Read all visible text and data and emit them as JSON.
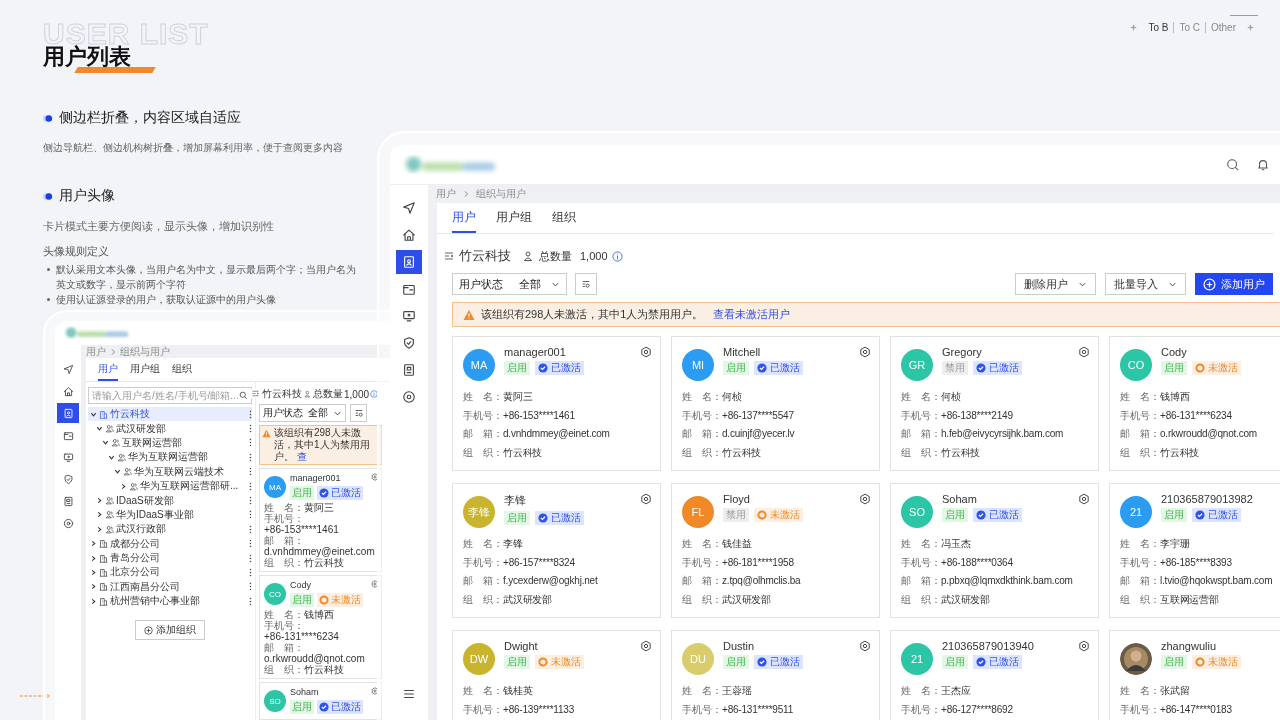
{
  "header": {
    "watermark": "USER LIST",
    "title": "用户列表",
    "links": [
      {
        "label": "To B",
        "selected": true
      },
      {
        "label": "To C",
        "selected": false
      },
      {
        "label": "Other",
        "selected": false
      }
    ]
  },
  "sections": [
    {
      "heading": "侧边栏折叠，内容区域自适应",
      "text": "侧边导航栏、侧边机构树折叠，增加屏幕利用率，便于查阅更多内容"
    },
    {
      "heading": "用户头像",
      "text": "卡片模式主要方便阅读，显示头像，增加识别性",
      "subheading": "头像规则定义",
      "bullets": [
        "默认采用文本头像，当用户名为中文，显示最后两个字；当用户名为英文或数字，显示前两个字符",
        "使用认证源登录的用户，获取认证源中的用户头像"
      ]
    }
  ],
  "mini": {
    "nav": [
      {
        "kind": "send",
        "selected": false
      },
      {
        "kind": "home",
        "selected": false
      },
      {
        "kind": "user",
        "selected": true
      },
      {
        "kind": "folder",
        "selected": false
      },
      {
        "kind": "monitor",
        "selected": false
      },
      {
        "kind": "shield",
        "selected": false
      },
      {
        "kind": "badge",
        "selected": false
      },
      {
        "kind": "settings",
        "selected": false
      }
    ],
    "breadcrumb": [
      "用户",
      "组织与用户"
    ],
    "tabs": [
      {
        "label": "用户",
        "selected": true
      },
      {
        "label": "用户组",
        "selected": false
      },
      {
        "label": "组织",
        "selected": false
      }
    ],
    "search": {
      "placeholder": "请输入用户名/姓名/手机号/邮箱..."
    },
    "tree": [
      {
        "label": "竹云科技",
        "kind": "org",
        "expanded": true,
        "selected": true,
        "children": [
          {
            "label": "武汉研发部",
            "kind": "dept",
            "expanded": true,
            "selected": false,
            "children": [
              {
                "label": "互联网运营部",
                "kind": "dept",
                "expanded": true,
                "selected": false,
                "children": [
                  {
                    "label": "华为互联网运营部",
                    "kind": "dept",
                    "expanded": true,
                    "selected": false,
                    "children": [
                      {
                        "label": "华为互联网云端技术",
                        "kind": "dept",
                        "expanded": true,
                        "selected": false,
                        "children": [
                          {
                            "label": "华为互联网运营部研...",
                            "kind": "dept",
                            "expanded": false,
                            "selected": false
                          }
                        ]
                      }
                    ]
                  }
                ]
              }
            ]
          },
          {
            "label": "IDaaS研发部",
            "kind": "dept",
            "expanded": false,
            "selected": false
          },
          {
            "label": "华为IDaaS事业部",
            "kind": "dept",
            "expanded": false,
            "selected": false
          },
          {
            "label": "武汉行政部",
            "kind": "dept",
            "expanded": false,
            "selected": false
          }
        ]
      },
      {
        "label": "成都分公司",
        "kind": "org",
        "expanded": false,
        "selected": false
      },
      {
        "label": "青岛分公司",
        "kind": "org",
        "expanded": false,
        "selected": false
      },
      {
        "label": "北京分公司",
        "kind": "org",
        "expanded": false,
        "selected": false
      },
      {
        "label": "江西南昌分公司",
        "kind": "org",
        "expanded": false,
        "selected": false
      },
      {
        "label": "杭州营销中心事业部",
        "kind": "org",
        "expanded": false,
        "selected": false
      }
    ],
    "add_org": "添加组织",
    "org": "竹云科技",
    "total_label": "总数量",
    "total": "1,000",
    "filter": {
      "label": "用户状态",
      "value": "全部"
    },
    "alert": {
      "text": "该组织有298人未激活，其中1人为禁用用户。",
      "link": "查"
    },
    "cards": [
      {
        "kind": "text",
        "avatar": "MA",
        "color": "#2b9cf2",
        "name": "manager001",
        "settings": true,
        "status": {
          "text": "启用",
          "enabled": true
        },
        "activation": {
          "text": "已激活",
          "activated": true
        },
        "fields": [
          {
            "label": "姓　名：",
            "value": "黄阿三"
          },
          {
            "label": "手机号：",
            "value": "+86-153****1461"
          },
          {
            "label": "邮　箱：",
            "value": "d.vnhdmmey@einet.com"
          },
          {
            "label": "组　织：",
            "value": "竹云科技"
          }
        ]
      },
      {
        "kind": "text",
        "avatar": "CO",
        "color": "#2cc5a5",
        "name": "Cody",
        "settings": true,
        "status": {
          "text": "启用",
          "enabled": true
        },
        "activation": {
          "text": "未激活",
          "activated": false
        },
        "fields": [
          {
            "label": "姓　名：",
            "value": "钱博西"
          },
          {
            "label": "手机号：",
            "value": "+86-131****6234"
          },
          {
            "label": "邮　箱：",
            "value": "o.rkwroudd@qnot.com"
          },
          {
            "label": "组　织：",
            "value": "竹云科技"
          }
        ]
      },
      {
        "kind": "text",
        "avatar": "SO",
        "color": "#2cc5a5",
        "name": "Soham",
        "settings": true,
        "status": {
          "text": "启用",
          "enabled": true
        },
        "activation": {
          "text": "已激活",
          "activated": true
        }
      }
    ]
  },
  "main": {
    "nav": [
      {
        "kind": "send",
        "selected": false
      },
      {
        "kind": "home",
        "selected": false
      },
      {
        "kind": "user",
        "selected": true
      },
      {
        "kind": "folder",
        "selected": false
      },
      {
        "kind": "monitor",
        "selected": false
      },
      {
        "kind": "shield",
        "selected": false
      },
      {
        "kind": "badge",
        "selected": false
      },
      {
        "kind": "settings",
        "selected": false
      }
    ],
    "bottom_nav": [
      {
        "kind": "list",
        "selected": false
      }
    ],
    "breadcrumb": [
      "用户",
      "组织与用户"
    ],
    "tabs": [
      {
        "label": "用户",
        "selected": true
      },
      {
        "label": "用户组",
        "selected": false
      },
      {
        "label": "组织",
        "selected": false
      }
    ],
    "org": "竹云科技",
    "total_label": "总数量",
    "total": "1,000",
    "filter": {
      "label": "用户状态",
      "value": "全部"
    },
    "actions": [
      {
        "label": "删除用户",
        "kind": "dropdown"
      },
      {
        "label": "批量导入",
        "kind": "dropdown"
      },
      {
        "label": "添加用户",
        "kind": "primary"
      }
    ],
    "alert": {
      "text": "该组织有298人未激活，其中1人为禁用用户。",
      "link": "查看未激活用户"
    },
    "cards": [
      {
        "kind": "text",
        "avatar": "MA",
        "color": "#2b9cf2",
        "name": "manager001",
        "settings": true,
        "status": {
          "text": "启用",
          "enabled": true
        },
        "activation": {
          "text": "已激活",
          "activated": true
        },
        "fields": [
          {
            "label": "姓　名：",
            "value": "黄阿三"
          },
          {
            "label": "手机号：",
            "value": "+86-153****1461"
          },
          {
            "label": "邮　箱：",
            "value": "d.vnhdmmey@einet.com"
          },
          {
            "label": "组　织：",
            "value": "竹云科技"
          }
        ]
      },
      {
        "kind": "text",
        "avatar": "MI",
        "color": "#2b9cf2",
        "name": "Mitchell",
        "settings": true,
        "status": {
          "text": "启用",
          "enabled": true
        },
        "activation": {
          "text": "已激活",
          "activated": true
        },
        "fields": [
          {
            "label": "姓　名：",
            "value": "何桢"
          },
          {
            "label": "手机号：",
            "value": "+86-137****5547"
          },
          {
            "label": "邮　箱：",
            "value": "d.cuinjf@yecer.lv"
          },
          {
            "label": "组　织：",
            "value": "竹云科技"
          }
        ]
      },
      {
        "kind": "text",
        "avatar": "GR",
        "color": "#2cc5a5",
        "name": "Gregory",
        "settings": true,
        "status": {
          "text": "禁用",
          "enabled": false
        },
        "activation": {
          "text": "已激活",
          "activated": true
        },
        "fields": [
          {
            "label": "姓　名：",
            "value": "何桢"
          },
          {
            "label": "手机号：",
            "value": "+86-138****2149"
          },
          {
            "label": "邮　箱：",
            "value": "h.feb@eivycyrsijhk.bam.com"
          },
          {
            "label": "组　织：",
            "value": "竹云科技"
          }
        ]
      },
      {
        "kind": "text",
        "avatar": "CO",
        "color": "#2cc5a5",
        "name": "Cody",
        "settings": false,
        "status": {
          "text": "启用",
          "enabled": true
        },
        "activation": {
          "text": "未激活",
          "activated": false
        },
        "fields": [
          {
            "label": "姓　名：",
            "value": "钱博西"
          },
          {
            "label": "手机号：",
            "value": "+86-131****6234"
          },
          {
            "label": "邮　箱：",
            "value": "o.rkwroudd@qnot.com"
          },
          {
            "label": "组　织：",
            "value": "竹云科技"
          }
        ]
      },
      {
        "kind": "text",
        "avatar": "李锋",
        "color": "#c9b42d",
        "name": "李锋",
        "settings": true,
        "status": {
          "text": "启用",
          "enabled": true
        },
        "activation": {
          "text": "已激活",
          "activated": true
        },
        "fields": [
          {
            "label": "姓　名：",
            "value": "李锋"
          },
          {
            "label": "手机号：",
            "value": "+86-157****8324"
          },
          {
            "label": "邮　箱：",
            "value": "f.ycexderw@ogkhj.net"
          },
          {
            "label": "组　织：",
            "value": "武汉研发部"
          }
        ]
      },
      {
        "kind": "text",
        "avatar": "FL",
        "color": "#f08a28",
        "name": "Floyd",
        "settings": true,
        "status": {
          "text": "禁用",
          "enabled": false
        },
        "activation": {
          "text": "未激活",
          "activated": false
        },
        "fields": [
          {
            "label": "姓　名：",
            "value": "钱佳益"
          },
          {
            "label": "手机号：",
            "value": "+86-181****1958"
          },
          {
            "label": "邮　箱：",
            "value": "z.tpq@olhmclis.ba"
          },
          {
            "label": "组　织：",
            "value": "武汉研发部"
          }
        ]
      },
      {
        "kind": "text",
        "avatar": "SO",
        "color": "#2cc5a5",
        "name": "Soham",
        "settings": true,
        "status": {
          "text": "启用",
          "enabled": true
        },
        "activation": {
          "text": "已激活",
          "activated": true
        },
        "fields": [
          {
            "label": "姓　名：",
            "value": "冯玉杰"
          },
          {
            "label": "手机号：",
            "value": "+86-188****0364"
          },
          {
            "label": "邮　箱：",
            "value": "p.pbxq@lqmxdkthink.bam.com"
          },
          {
            "label": "组　织：",
            "value": "武汉研发部"
          }
        ]
      },
      {
        "kind": "text",
        "avatar": "21",
        "color": "#2b9cf2",
        "name": "210365879013982",
        "settings": false,
        "status": {
          "text": "启用",
          "enabled": true
        },
        "activation": {
          "text": "已激活",
          "activated": true
        },
        "fields": [
          {
            "label": "姓　名：",
            "value": "李宇珊"
          },
          {
            "label": "手机号：",
            "value": "+86-185****8393"
          },
          {
            "label": "邮　箱：",
            "value": "l.tvio@hqokwspt.bam.com"
          },
          {
            "label": "组　织：",
            "value": "互联网运营部"
          }
        ]
      },
      {
        "kind": "text",
        "avatar": "DW",
        "color": "#c9b42d",
        "name": "Dwight",
        "settings": true,
        "status": {
          "text": "启用",
          "enabled": true
        },
        "activation": {
          "text": "未激活",
          "activated": false
        },
        "fields": [
          {
            "label": "姓　名：",
            "value": "钱桂英"
          },
          {
            "label": "手机号：",
            "value": "+86-139****1133"
          }
        ]
      },
      {
        "kind": "text",
        "avatar": "DU",
        "color": "#d8cc6c",
        "name": "Dustin",
        "settings": true,
        "status": {
          "text": "启用",
          "enabled": true
        },
        "activation": {
          "text": "已激活",
          "activated": true
        },
        "fields": [
          {
            "label": "姓　名：",
            "value": "王蓉瑶"
          },
          {
            "label": "手机号：",
            "value": "+86-131****9511"
          }
        ]
      },
      {
        "kind": "text",
        "avatar": "21",
        "color": "#2cc5a5",
        "name": "210365879013940",
        "settings": true,
        "status": {
          "text": "启用",
          "enabled": true
        },
        "activation": {
          "text": "已激活",
          "activated": true
        },
        "fields": [
          {
            "label": "姓　名：",
            "value": "王杰应"
          },
          {
            "label": "手机号：",
            "value": "+86-127****8692"
          }
        ]
      },
      {
        "name": "zhangwuliu",
        "settings": false,
        "status": {
          "text": "启用",
          "enabled": true
        },
        "activation": {
          "text": "未激活",
          "activated": false
        },
        "fields": [
          {
            "label": "姓　名：",
            "value": "张武留"
          },
          {
            "label": "手机号：",
            "value": "+86-147****0183"
          }
        ]
      }
    ]
  }
}
